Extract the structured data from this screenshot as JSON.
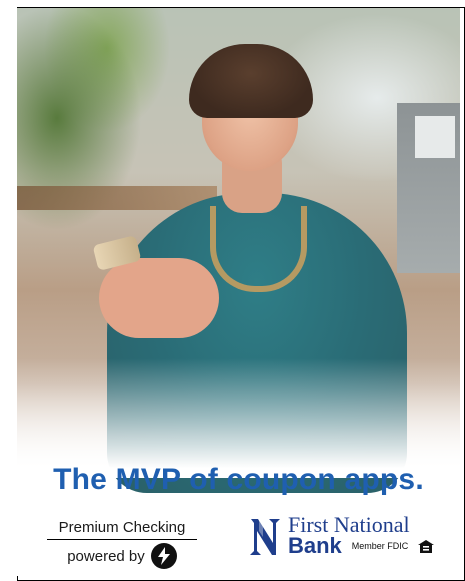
{
  "ad": {
    "headline": "The MVP of coupon apps.",
    "premium_label": "Premium Checking",
    "powered_by_label": "powered by",
    "powered_icon": "lightning-bolt-icon",
    "bank_name_line1": "First National",
    "bank_name_line2": "Bank",
    "member_fdic": "Member FDIC",
    "housing_icon": "equal-housing-lender-icon",
    "colors": {
      "headline": "#1f5fb0",
      "bank_blue": "#1f3e8c"
    }
  }
}
